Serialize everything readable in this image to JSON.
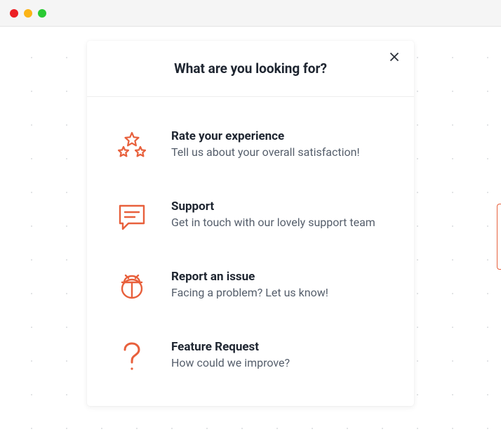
{
  "colors": {
    "accent": "#e8603c"
  },
  "modal": {
    "title": "What are you looking for?"
  },
  "options": [
    {
      "icon": "stars-icon",
      "title": "Rate your experience",
      "desc": "Tell us about your overall satisfaction!"
    },
    {
      "icon": "chat-icon",
      "title": "Support",
      "desc": "Get in touch with our lovely support team"
    },
    {
      "icon": "bug-icon",
      "title": "Report an issue",
      "desc": "Facing a problem? Let us know!"
    },
    {
      "icon": "question-icon",
      "title": "Feature Request",
      "desc": "How could we improve?"
    }
  ]
}
